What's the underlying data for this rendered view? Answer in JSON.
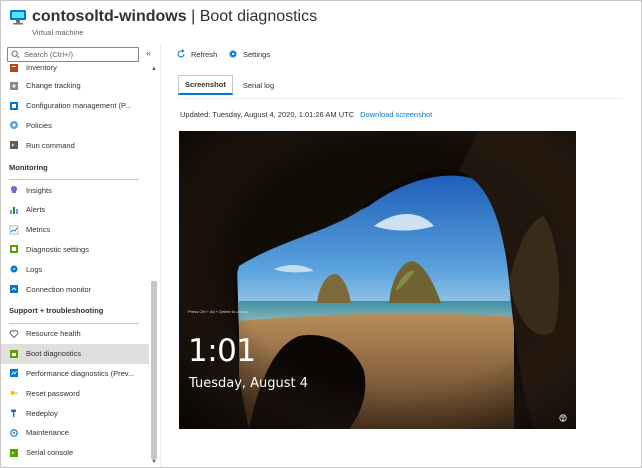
{
  "header": {
    "resource_name": "contosoltd-windows",
    "separator": " | ",
    "page_name": "Boot diagnostics",
    "subtitle": "Virtual machine"
  },
  "sidebar": {
    "search_placeholder": "Search (Ctrl+/)",
    "collapse_glyph": "«",
    "items_top": [
      {
        "label": "Inventory",
        "icon": "inventory-icon"
      },
      {
        "label": "Change tracking",
        "icon": "change-tracking-icon"
      },
      {
        "label": "Configuration management (P...",
        "icon": "configuration-icon"
      },
      {
        "label": "Policies",
        "icon": "policies-icon"
      },
      {
        "label": "Run command",
        "icon": "run-command-icon"
      }
    ],
    "monitoring": {
      "title": "Monitoring",
      "items": [
        {
          "label": "Insights",
          "icon": "insights-icon"
        },
        {
          "label": "Alerts",
          "icon": "alerts-icon"
        },
        {
          "label": "Metrics",
          "icon": "metrics-icon"
        },
        {
          "label": "Diagnostic settings",
          "icon": "diagnostic-settings-icon"
        },
        {
          "label": "Logs",
          "icon": "logs-icon"
        },
        {
          "label": "Connection monitor",
          "icon": "connection-monitor-icon"
        }
      ]
    },
    "support": {
      "title": "Support + troubleshooting",
      "items": [
        {
          "label": "Resource health",
          "icon": "heart-icon"
        },
        {
          "label": "Boot diagnostics",
          "icon": "boot-diagnostics-icon",
          "active": true
        },
        {
          "label": "Performance diagnostics (Prev...",
          "icon": "performance-icon"
        },
        {
          "label": "Reset password",
          "icon": "key-icon"
        },
        {
          "label": "Redeploy",
          "icon": "hammer-icon"
        },
        {
          "label": "Maintenance",
          "icon": "maintenance-icon"
        },
        {
          "label": "Serial console",
          "icon": "console-icon"
        }
      ]
    }
  },
  "toolbar": {
    "refresh_label": "Refresh",
    "settings_label": "Settings"
  },
  "tabs": {
    "screenshot_label": "Screenshot",
    "serial_log_label": "Serial log"
  },
  "status": {
    "updated_text": "Updated: Tuesday, August 4, 2020, 1:01:26 AM UTC",
    "download_link": "Download screenshot"
  },
  "lockscreen": {
    "hint": "Press Ctrl + Alt + Delete to unlock",
    "time": "1:01",
    "date": "Tuesday, August 4"
  },
  "colors": {
    "accent": "#0078d4",
    "active_nav": "#e1dfdd"
  }
}
